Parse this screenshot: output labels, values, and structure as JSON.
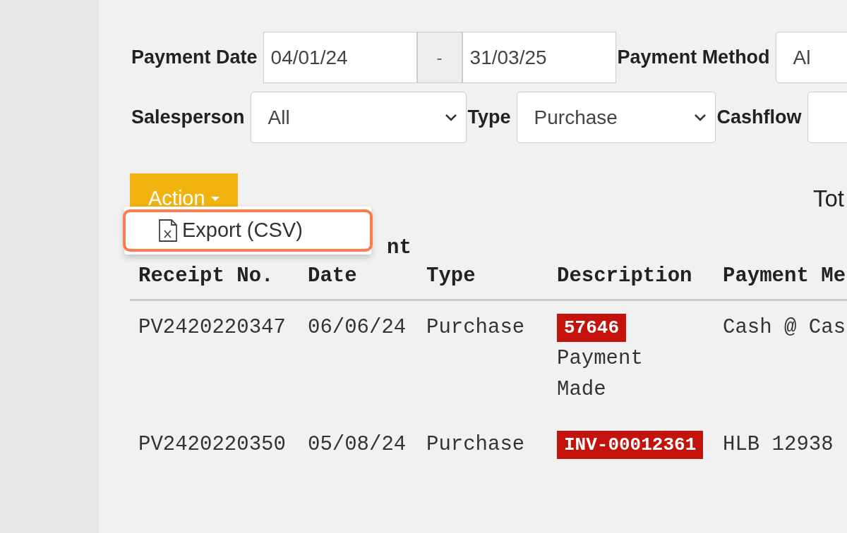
{
  "filters": [
    {
      "items": [
        {
          "kind": "label",
          "text": "Payment Date"
        },
        {
          "kind": "input",
          "value": "04/01/24"
        },
        {
          "kind": "addon",
          "text": "-"
        },
        {
          "kind": "input",
          "value": "31/03/25"
        },
        {
          "kind": "label",
          "text": "Payment Method"
        },
        {
          "kind": "select",
          "value": "Al"
        }
      ]
    },
    {
      "items": [
        {
          "kind": "label",
          "text": "Salesperson"
        },
        {
          "kind": "select",
          "value": "All"
        },
        {
          "kind": "label",
          "text": "Type"
        },
        {
          "kind": "select",
          "value": "Purchase"
        },
        {
          "kind": "label",
          "text": "Cashflow"
        },
        {
          "kind": "select"
        }
      ]
    }
  ],
  "action_button": {
    "label": "Action",
    "expanded": true
  },
  "action_menu": [
    {
      "label": "Export (CSV)"
    }
  ],
  "total_label": "Tot",
  "table": {
    "group_header": "nt",
    "columns": [
      "Receipt No.",
      "Date",
      "Type",
      "Description",
      "Payment Me"
    ],
    "rows": [
      {
        "receipt": "PV2420220347",
        "date": "06/06/24",
        "type": "Purchase",
        "tag": "57646",
        "description": "Payment Made",
        "payment": "Cash @ Cas"
      },
      {
        "receipt": "PV2420220350",
        "date": "05/08/24",
        "type": "Purchase",
        "tag": "INV-00012361",
        "payment": "HLB 12938"
      }
    ]
  }
}
